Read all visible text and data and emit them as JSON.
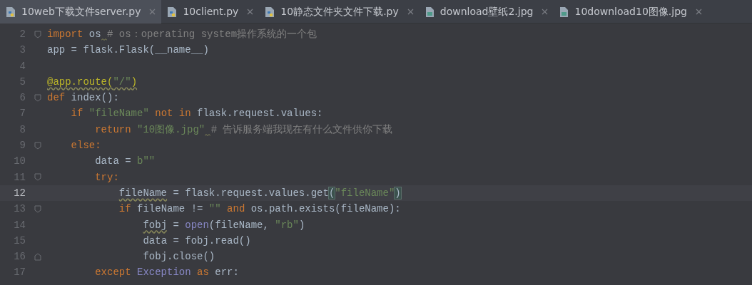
{
  "tabs": [
    {
      "label": "10web下载文件server.py",
      "kind": "python",
      "selected": true
    },
    {
      "label": "10client.py",
      "kind": "python",
      "selected": false
    },
    {
      "label": "10静态文件夹文件下载.py",
      "kind": "python",
      "selected": false
    },
    {
      "label": "download壁纸2.jpg",
      "kind": "image",
      "selected": false
    },
    {
      "label": "10download10图像.jpg",
      "kind": "image",
      "selected": false
    }
  ],
  "editor": {
    "lines": [
      {
        "number": "2",
        "fold_start": true,
        "fold_end": false,
        "current": false,
        "tokens": [
          {
            "t": "import",
            "kind": "kw"
          },
          {
            "t": " os",
            "kind": "plain"
          },
          {
            "kind": "warning_space"
          },
          {
            "t": "# os：operating system操作系统的一个包",
            "kind": "comment"
          }
        ]
      },
      {
        "number": "3",
        "fold_start": false,
        "fold_end": false,
        "current": false,
        "tokens": [
          {
            "t": "app = flask.Flask(__name__)",
            "kind": "plain"
          }
        ]
      },
      {
        "number": "4",
        "fold_start": false,
        "fold_end": false,
        "current": false
      },
      {
        "number": "5",
        "fold_start": false,
        "fold_end": false,
        "current": false,
        "tokens": [
          {
            "t": "@app.route(",
            "kind": "deco",
            "warn": true
          },
          {
            "t": "\"/\"",
            "kind": "str",
            "warn": true
          },
          {
            "t": ")",
            "kind": "deco",
            "warn": true
          }
        ]
      },
      {
        "number": "6",
        "fold_start": true,
        "fold_end": false,
        "current": false,
        "tokens": [
          {
            "t": "def",
            "kind": "kw"
          },
          {
            "t": " index():",
            "kind": "plain"
          }
        ],
        "children": [
          {
            "number": "7",
            "fold_start": false,
            "fold_end": false,
            "current": false,
            "tokens": [
              {
                "t": "if ",
                "kind": "kw"
              },
              {
                "t": "\"fileName\"",
                "kind": "str"
              },
              {
                "t": " not in ",
                "kind": "kw"
              },
              {
                "t": "flask.request.values:",
                "kind": "plain"
              }
            ],
            "children": [
              {
                "number": "8",
                "fold_start": false,
                "fold_end": false,
                "current": false,
                "tokens": [
                  {
                    "t": "return ",
                    "kind": "kw"
                  },
                  {
                    "t": "\"10图像.jpg\"",
                    "kind": "str"
                  },
                  {
                    "kind": "warning_space"
                  },
                  {
                    "t": "# 告诉服务端我现在有什么文件供你下载",
                    "kind": "comment"
                  }
                ]
              }
            ]
          },
          {
            "number": "9",
            "fold_start": true,
            "fold_end": false,
            "current": false,
            "tokens": [
              {
                "t": "else:",
                "kind": "kw"
              }
            ],
            "children": [
              {
                "number": "10",
                "fold_start": false,
                "fold_end": false,
                "current": false,
                "tokens": [
                  {
                    "t": "data = ",
                    "kind": "plain"
                  },
                  {
                    "t": "b\"\"",
                    "kind": "str"
                  }
                ]
              },
              {
                "number": "11",
                "fold_start": true,
                "fold_end": false,
                "current": false,
                "tokens": [
                  {
                    "t": "try:",
                    "kind": "kw"
                  }
                ],
                "children": [
                  {
                    "number": "12",
                    "fold_start": false,
                    "fold_end": false,
                    "current": true,
                    "tokens": [
                      {
                        "t": "fileName",
                        "kind": "plain",
                        "warn": true
                      },
                      {
                        "t": " = flask.request.values.get",
                        "kind": "plain"
                      },
                      {
                        "t": "(",
                        "kind": "plain",
                        "match": true
                      },
                      {
                        "t": "\"fileName\"",
                        "kind": "str"
                      },
                      {
                        "t": ")",
                        "kind": "plain",
                        "match": true
                      }
                    ]
                  },
                  {
                    "number": "13",
                    "fold_start": true,
                    "fold_end": false,
                    "current": false,
                    "tokens": [
                      {
                        "t": "if ",
                        "kind": "kw"
                      },
                      {
                        "t": "fileName != ",
                        "kind": "plain"
                      },
                      {
                        "t": "\"\"",
                        "kind": "str"
                      },
                      {
                        "t": " and ",
                        "kind": "kw"
                      },
                      {
                        "t": "os.path.exists(fileName):",
                        "kind": "plain"
                      }
                    ],
                    "children": [
                      {
                        "number": "14",
                        "fold_start": false,
                        "fold_end": false,
                        "current": false,
                        "tokens": [
                          {
                            "t": "fobj",
                            "kind": "plain",
                            "warn": true
                          },
                          {
                            "t": " = ",
                            "kind": "plain"
                          },
                          {
                            "t": "open",
                            "kind": "builtin"
                          },
                          {
                            "t": "(fileName, ",
                            "kind": "plain"
                          },
                          {
                            "t": "\"rb\"",
                            "kind": "str"
                          },
                          {
                            "t": ")",
                            "kind": "plain"
                          }
                        ]
                      },
                      {
                        "number": "15",
                        "fold_start": false,
                        "fold_end": false,
                        "current": false,
                        "tokens": [
                          {
                            "t": "data = fobj.read()",
                            "kind": "plain"
                          }
                        ]
                      },
                      {
                        "number": "16",
                        "fold_start": false,
                        "fold_end": true,
                        "current": false,
                        "tokens": [
                          {
                            "t": "fobj.close()",
                            "kind": "plain"
                          }
                        ]
                      }
                    ]
                  }
                ]
              },
              {
                "number": "17",
                "fold_start": false,
                "fold_end": false,
                "current": false,
                "tokens": [
                  {
                    "t": "except ",
                    "kind": "kw"
                  },
                  {
                    "t": "Exception",
                    "kind": "builtin"
                  },
                  {
                    "t": " as ",
                    "kind": "kw"
                  },
                  {
                    "t": "err:",
                    "kind": "plain"
                  }
                ]
              }
            ]
          }
        ]
      }
    ]
  }
}
